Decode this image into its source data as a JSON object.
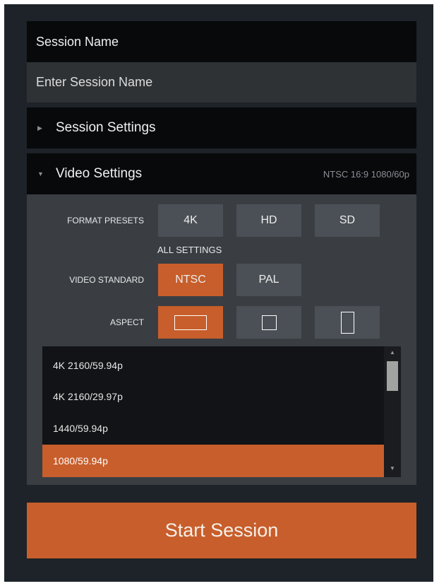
{
  "header": {
    "title": "Session Name"
  },
  "session_name_input": {
    "value": "",
    "placeholder": "Enter Session Name"
  },
  "session_settings": {
    "label": "Session Settings",
    "arrow": "▶"
  },
  "video_settings": {
    "label": "Video Settings",
    "arrow": "▼",
    "summary": "NTSC 16:9 1080/60p",
    "format_presets": {
      "label": "FORMAT PRESETS",
      "options": [
        "4K",
        "HD",
        "SD"
      ]
    },
    "all_settings_label": "ALL SETTINGS",
    "video_standard": {
      "label": "VIDEO STANDARD",
      "options": [
        "NTSC",
        "PAL"
      ],
      "selected": "NTSC"
    },
    "aspect": {
      "label": "ASPECT",
      "options": [
        "16:9",
        "4:3",
        "9:16"
      ],
      "selected": "16:9"
    },
    "resolutions": {
      "items": [
        "4K 2160/59.94p",
        "4K 2160/29.97p",
        "1440/59.94p",
        "1080/59.94p"
      ],
      "selected": "1080/59.94p"
    }
  },
  "start_button": {
    "label": "Start Session"
  },
  "colors": {
    "accent": "#c85e2b",
    "panel": "#1d2328",
    "bar": "#07090b",
    "body": "#3a3e43"
  }
}
